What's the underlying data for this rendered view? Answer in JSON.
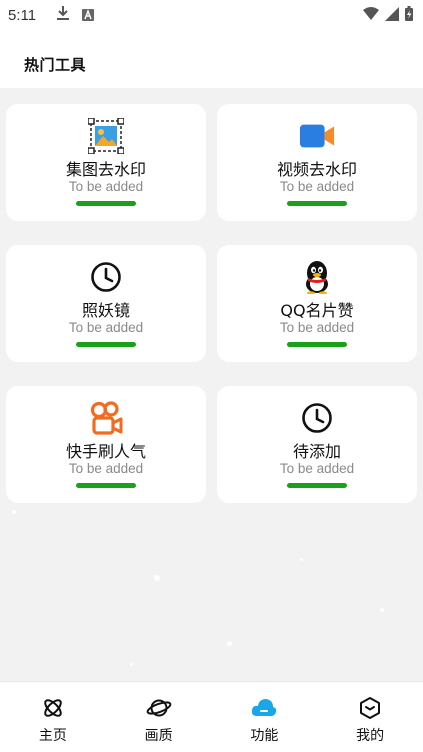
{
  "status_bar": {
    "time": "5:11"
  },
  "header": {
    "title": "热门工具"
  },
  "cards": [
    {
      "title": "集图去水印",
      "subtitle": "To be added",
      "icon": "image-watermark-icon"
    },
    {
      "title": "视频去水印",
      "subtitle": "To be added",
      "icon": "video-camera-icon"
    },
    {
      "title": "照妖镜",
      "subtitle": "To be added",
      "icon": "clock-icon"
    },
    {
      "title": "QQ名片赞",
      "subtitle": "To be added",
      "icon": "qq-penguin-icon"
    },
    {
      "title": "快手刷人气",
      "subtitle": "To be added",
      "icon": "kuaishou-icon"
    },
    {
      "title": "待添加",
      "subtitle": "To be added",
      "icon": "clock-icon"
    }
  ],
  "bottom_nav": [
    {
      "label": "主页",
      "icon": "atom-icon",
      "active": false
    },
    {
      "label": "画质",
      "icon": "planet-icon",
      "active": false
    },
    {
      "label": "功能",
      "icon": "cloud-icon",
      "active": true
    },
    {
      "label": "我的",
      "icon": "cube-icon",
      "active": false
    }
  ],
  "colors": {
    "accent_bar": "#1aa11a",
    "active_nav": "#1aa7e8",
    "background": "#f2f2f2"
  }
}
